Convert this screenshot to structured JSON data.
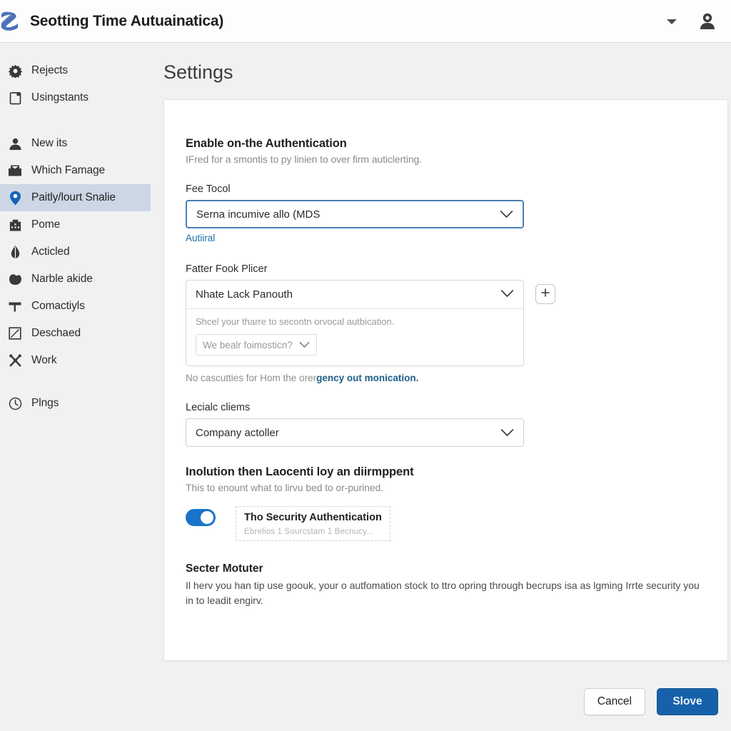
{
  "header": {
    "logo_icon": "z-logo-icon",
    "title": "Seotting Time Autuainatica)",
    "chevron_icon": "chevron-down-icon",
    "avatar_icon": "user-avatar-icon"
  },
  "sidebar": {
    "groups": [
      {
        "items": [
          {
            "icon": "gear-icon",
            "label": "Rejects",
            "active": false
          },
          {
            "icon": "document-icon",
            "label": "Usingstants",
            "active": false
          }
        ]
      },
      {
        "items": [
          {
            "icon": "person-icon",
            "label": "New its",
            "active": false
          },
          {
            "icon": "inbox-icon",
            "label": "Which Famage",
            "active": false
          },
          {
            "icon": "location-pin-icon",
            "label": "Paitly/lourt Snalie",
            "active": true
          },
          {
            "icon": "building-icon",
            "label": "Pome",
            "active": false
          },
          {
            "icon": "droplet-icon",
            "label": "Acticled",
            "active": false
          },
          {
            "icon": "blob-icon",
            "label": "Narble akide",
            "active": false
          },
          {
            "icon": "hammer-icon",
            "label": "Comactiyls",
            "active": false
          },
          {
            "icon": "checkbox-square-icon",
            "label": "Deschaed",
            "active": false
          },
          {
            "icon": "tools-icon",
            "label": "Work",
            "active": false
          }
        ]
      },
      {
        "items": [
          {
            "icon": "clock-icon",
            "label": "Plngs",
            "active": false
          }
        ]
      }
    ]
  },
  "main": {
    "page_title": "Settings",
    "section": {
      "title": "Enable on-the Authentication",
      "subtitle": "IFred for a smontis to py linien to over firm auticlerting."
    },
    "field1": {
      "label": "Fee Tocol",
      "value": "Serna incumive allo (MDS",
      "chevron_icon": "chevron-down-icon",
      "link": "Autiiral"
    },
    "field2": {
      "label": "Fatter Fook Plicer",
      "value": "Nhate Lack Panouth",
      "chevron_icon": "chevron-down-icon",
      "add_icon": "plus-icon",
      "panel_note": "Shcel your tharre to secontn orvocal autbication.",
      "mini_select_value": "We bealr foimosticn?",
      "mini_chevron_icon": "chevron-down-icon",
      "helper_prefix": "No cascutties for Hom the orer",
      "helper_link": "gency out monication."
    },
    "field3": {
      "label": "Lecialc cliems",
      "value": "Company actoller",
      "chevron_icon": "chevron-down-icon"
    },
    "toggle_section": {
      "title": "Inolution then Laocenti loy an diirmppent",
      "subtitle": "This to enount what to lirvu bed to or-purined.",
      "toggle_on": true,
      "badge_title": "Tho Security Authentication",
      "badge_sub": "Ebrelios  1 Sourcstam  1 Becnucy..."
    },
    "footer_note": {
      "title": "Secter Motuter",
      "text": "Il herv you han tip use goouk, your o autfomation stock to ttro opring through becrups isa as lgming Irrte security you in to leadit engirv."
    }
  },
  "bottombar": {
    "cancel_label": "Cancel",
    "save_label": "Slove"
  },
  "colors": {
    "accent": "#1761ab",
    "link": "#1a6ea8",
    "active_nav_bg": "#ccd6e4",
    "toggle_on": "#1a73c8",
    "page_bg": "#f1f1f1"
  }
}
